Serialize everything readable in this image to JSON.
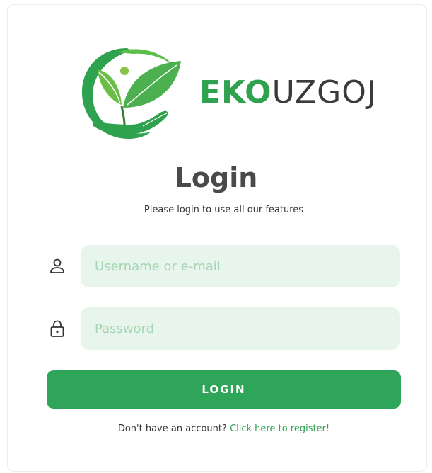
{
  "brand": {
    "name_bold": "EKO",
    "name_light": "UZGOJ",
    "colors": {
      "green": "#2ea24f",
      "dark": "#3b3b3b"
    }
  },
  "login": {
    "title": "Login",
    "subtitle": "Please login to use all our features"
  },
  "form": {
    "username": {
      "icon": "user-icon",
      "placeholder": "Username or e-mail",
      "value": ""
    },
    "password": {
      "icon": "lock-icon",
      "placeholder": "Password",
      "value": ""
    },
    "submit_label": "LOGIN"
  },
  "register": {
    "prompt": "Don't have an account?",
    "link_label": "Click here to register!"
  },
  "colors": {
    "accent": "#2ea558",
    "field_bg": "#e8f5ec",
    "placeholder": "#a5d6b3"
  }
}
